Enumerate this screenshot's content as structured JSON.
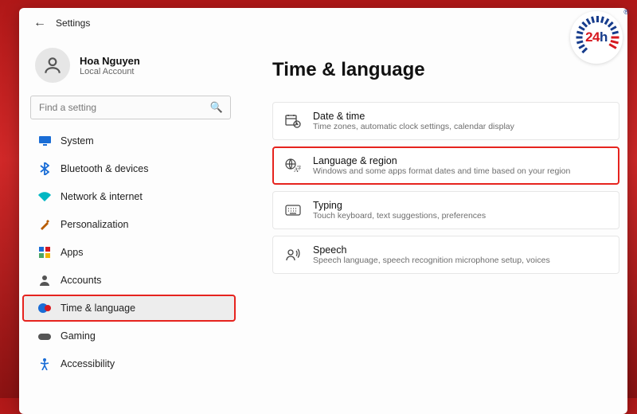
{
  "header": {
    "title": "Settings"
  },
  "profile": {
    "name": "Hoa Nguyen",
    "subtitle": "Local Account"
  },
  "search": {
    "placeholder": "Find a setting"
  },
  "sidebar": {
    "items": [
      {
        "icon": "monitor-icon",
        "label": "System"
      },
      {
        "icon": "bluetooth-icon",
        "label": "Bluetooth & devices"
      },
      {
        "icon": "wifi-icon",
        "label": "Network & internet"
      },
      {
        "icon": "brush-icon",
        "label": "Personalization"
      },
      {
        "icon": "apps-icon",
        "label": "Apps"
      },
      {
        "icon": "person-icon",
        "label": "Accounts"
      },
      {
        "icon": "globe-clock-icon",
        "label": "Time & language",
        "selected": true
      },
      {
        "icon": "gamepad-icon",
        "label": "Gaming"
      },
      {
        "icon": "accessibility-icon",
        "label": "Accessibility"
      }
    ]
  },
  "main": {
    "title": "Time & language",
    "cards": [
      {
        "icon": "calendar-clock-icon",
        "title": "Date & time",
        "subtitle": "Time zones, automatic clock settings, calendar display"
      },
      {
        "icon": "globe-letter-icon",
        "title": "Language & region",
        "subtitle": "Windows and some apps format dates and time based on your region",
        "highlighted": true
      },
      {
        "icon": "keyboard-icon",
        "title": "Typing",
        "subtitle": "Touch keyboard, text suggestions, preferences"
      },
      {
        "icon": "speech-icon",
        "title": "Speech",
        "subtitle": "Speech language, speech recognition microphone setup, voices"
      }
    ]
  },
  "watermark": {
    "text_num": "24",
    "text_h": "h",
    "registered": "®"
  }
}
